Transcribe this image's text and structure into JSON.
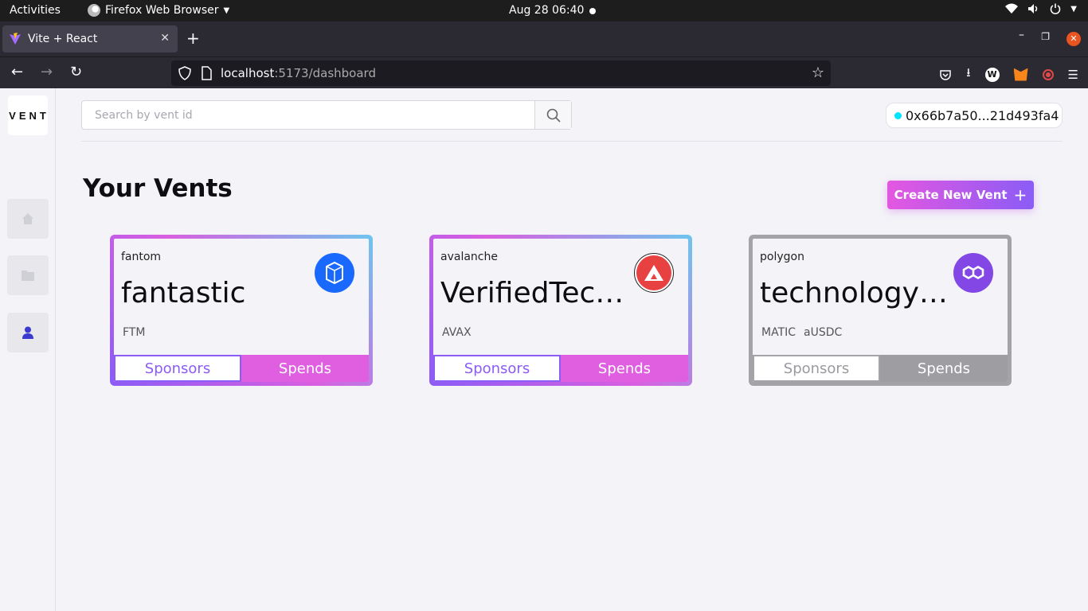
{
  "system": {
    "activities": "Activities",
    "app_name": "Firefox Web Browser",
    "clock": "Aug 28  06:40"
  },
  "browser": {
    "tab_title": "Vite + React",
    "url_host": "localhost",
    "url_rest": ":5173/dashboard"
  },
  "app": {
    "logo": "VENT",
    "search": {
      "placeholder": "Search by vent id"
    },
    "wallet": "0x66b7a50...21d493fa4",
    "title": "Your Vents",
    "create_button": "Create New Vent",
    "create_icon": "+"
  },
  "vents": [
    {
      "chain": "fantom",
      "name": "fantastic",
      "tokens": [
        "FTM"
      ],
      "sponsors": "Sponsors",
      "spends": "Spends",
      "coin_color": "#1969ff",
      "icon": "fantom-logo-icon"
    },
    {
      "chain": "avalanche",
      "name": "VerifiedTechnology",
      "tokens": [
        "AVAX"
      ],
      "sponsors": "Sponsors",
      "spends": "Spends",
      "coin_color": "#e84142",
      "icon": "avalanche-logo-icon"
    },
    {
      "chain": "polygon",
      "name": "technologyexpert",
      "tokens": [
        "MATIC",
        "aUSDC"
      ],
      "sponsors": "Sponsors",
      "spends": "Spends",
      "coin_color": "#8247e5",
      "icon": "polygon-logo-icon"
    }
  ]
}
